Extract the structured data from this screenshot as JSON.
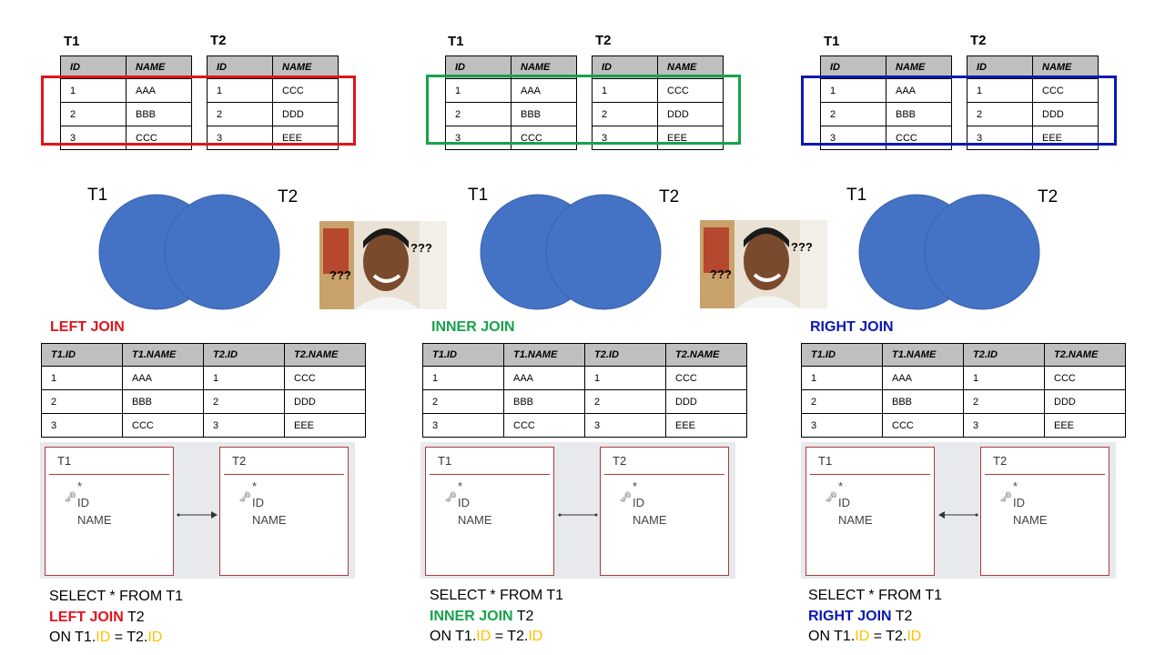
{
  "colors": {
    "left": "#e0141c",
    "inner": "#16a34a",
    "right": "#0b18b3",
    "venn": "#4472c4",
    "id_highlight": "#ffc000",
    "header_bg": "#bfbfbf"
  },
  "source_tables": {
    "t1_label": "T1",
    "t2_label": "T2",
    "headers": [
      "ID",
      "NAME"
    ],
    "t1_rows": [
      [
        "1",
        "AAA"
      ],
      [
        "2",
        "BBB"
      ],
      [
        "3",
        "CCC"
      ]
    ],
    "t2_rows": [
      [
        "1",
        "CCC"
      ],
      [
        "2",
        "DDD"
      ],
      [
        "3",
        "EEE"
      ]
    ]
  },
  "venn": {
    "left_label": "T1",
    "right_label": "T2"
  },
  "meme": {
    "question_marks": "???"
  },
  "result": {
    "headers": [
      "T1.ID",
      "T1.NAME",
      "T2.ID",
      "T2.NAME"
    ],
    "rows": [
      [
        "1",
        "AAA",
        "1",
        "CCC"
      ],
      [
        "2",
        "BBB",
        "2",
        "DDD"
      ],
      [
        "3",
        "CCC",
        "3",
        "EEE"
      ]
    ]
  },
  "relationship": {
    "t1_name": "T1",
    "t2_name": "T2",
    "star": "*",
    "id_field": "ID",
    "name_field": "NAME",
    "key_icon": "key-icon"
  },
  "sections": [
    {
      "title": "LEFT JOIN",
      "kw": "LEFT JOIN"
    },
    {
      "title": "INNER JOIN",
      "kw": "INNER JOIN"
    },
    {
      "title": "RIGHT JOIN",
      "kw": "RIGHT JOIN"
    }
  ],
  "sql": {
    "line1": "SELECT * FROM T1",
    "t2": " T2",
    "on": "ON T1.",
    "id": "ID",
    "eq": " = T2."
  }
}
